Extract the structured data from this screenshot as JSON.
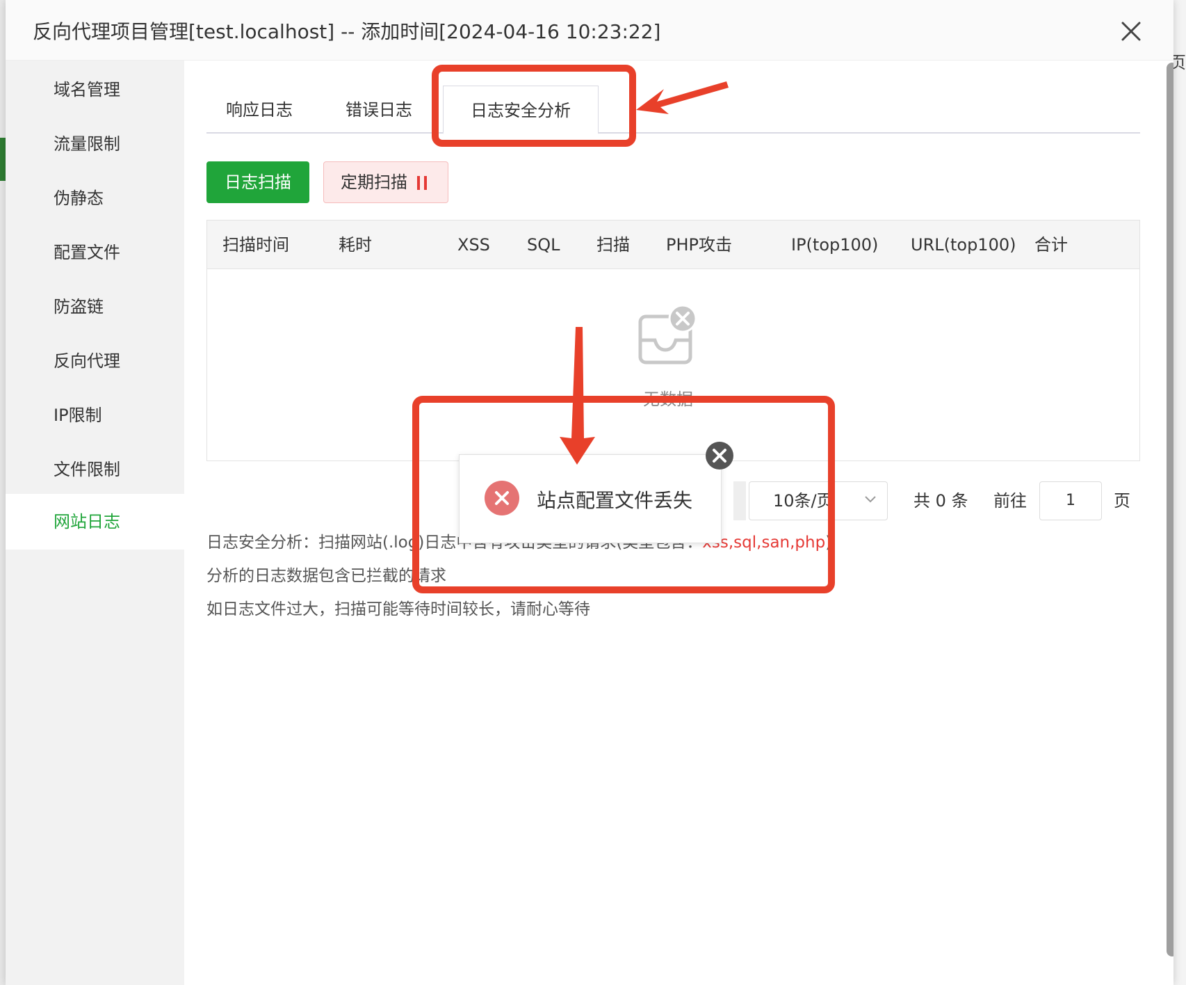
{
  "background": {
    "edge_char": "页"
  },
  "dialog": {
    "title": "反向代理项目管理[test.localhost] -- 添加时间[2024-04-16 10:23:22]"
  },
  "sidebar": {
    "items": [
      {
        "label": "域名管理"
      },
      {
        "label": "流量限制"
      },
      {
        "label": "伪静态"
      },
      {
        "label": "配置文件"
      },
      {
        "label": "防盗链"
      },
      {
        "label": "反向代理"
      },
      {
        "label": "IP限制"
      },
      {
        "label": "文件限制"
      },
      {
        "label": "网站日志",
        "active": true
      }
    ]
  },
  "tabs": [
    {
      "label": "响应日志"
    },
    {
      "label": "错误日志"
    },
    {
      "label": "日志安全分析",
      "active": true
    }
  ],
  "toolbar": {
    "scan_label": "日志扫描",
    "periodic_label": "定期扫描"
  },
  "table": {
    "columns": [
      "扫描时间",
      "耗时",
      "XSS",
      "SQL",
      "扫描",
      "PHP攻击",
      "IP(top100)",
      "URL(top100)",
      "合计"
    ],
    "empty_text": "无数据"
  },
  "pager": {
    "page_size": "10条/页",
    "total": "共 0 条",
    "goto_label": "前往",
    "page_value": "1",
    "page_suffix": "页"
  },
  "description": {
    "line1_prefix": "日志安全分析：扫描网站(.log)日志中含有攻击类型的请求(类型包含：",
    "line1_types": "xss,sql,san,php",
    "line1_suffix": ")",
    "line2": "分析的日志数据包含已拦截的请求",
    "line3": "如日志文件过大，扫描可能等待时间较长，请耐心等待"
  },
  "toast": {
    "message": "站点配置文件丢失"
  },
  "colors": {
    "accent_green": "#20a53a",
    "annotation_red": "#e8402a",
    "error_red": "#e57373"
  }
}
